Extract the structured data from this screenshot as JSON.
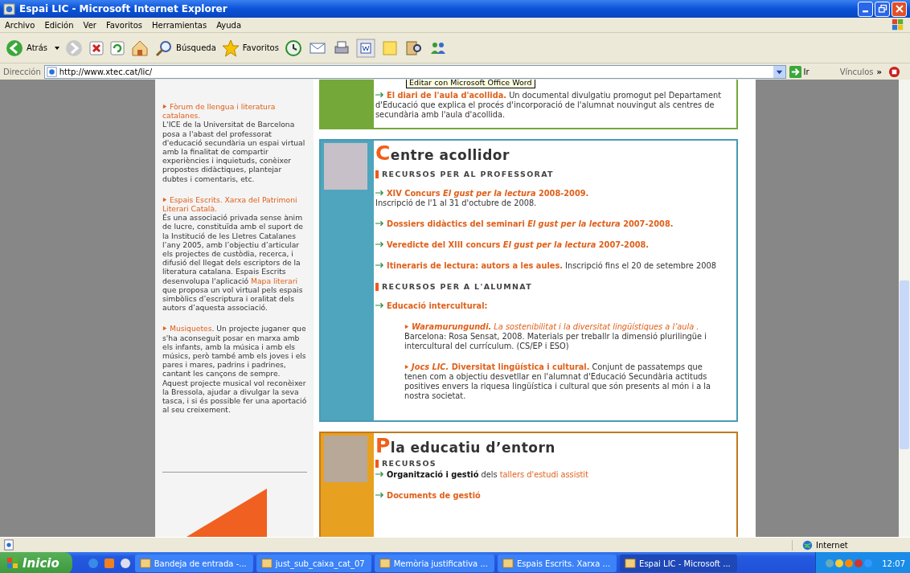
{
  "window": {
    "title": "Espai LIC - Microsoft Internet Explorer"
  },
  "menu": [
    "Archivo",
    "Edición",
    "Ver",
    "Favoritos",
    "Herramientas",
    "Ayuda"
  ],
  "toolbar": {
    "back": "Atrás",
    "search": "Búsqueda",
    "favorites": "Favoritos"
  },
  "address": {
    "label": "Dirección",
    "value": "http://www.xtec.cat/lic/",
    "go": "Ir",
    "links": "Vínculos",
    "more": "»"
  },
  "tooltip": "Editar con Microsoft Office Word",
  "sidebar": [
    {
      "paragraphs": [
        [
          {
            "kind": "link",
            "text": "Fòrum de llengua i literatura catalanes."
          }
        ],
        [
          {
            "kind": "text",
            "text": "L'ICE de la Universitat de Barcelona posa a l'abast del professorat d'educació secundària un espai virtual amb la finalitat de compartir experiències i inquietuds, conèixer propostes didàctiques, plantejar dubtes i comentaris, etc."
          }
        ]
      ]
    },
    {
      "paragraphs": [
        [
          {
            "kind": "link",
            "text": "Espais Escrits. Xarxa del Patrimoni Literari Català."
          }
        ],
        [
          {
            "kind": "text",
            "text": "És una associació privada sense ànim de lucre, constituïda amb el suport de la Institució de les Lletres Catalanes l’any 2005, amb l’objectiu d’articular els projectes de custòdia, recerca, i difusió del llegat dels escriptors de la literatura catalana. Espais Escrits desenvolupa l'aplicació "
          },
          {
            "kind": "link",
            "text": "Mapa literari"
          },
          {
            "kind": "text",
            "text": " que proposa un vol virtual pels espais simbòlics d’escriptura i oralitat dels autors d’aquesta associació."
          }
        ]
      ]
    },
    {
      "paragraphs": [
        [
          {
            "kind": "link",
            "text": "Musiquetes"
          },
          {
            "kind": "text",
            "text": ". Un projecte juganer que s'ha aconseguit posar en marxa amb els infants, amb la música i amb els músics, però també amb els joves i els pares i mares, padrins i padrines, cantant les cançons de sempre."
          }
        ],
        [
          {
            "kind": "text",
            "text": "Aquest projecte musical vol reconèixer la Bressola, ajudar a divulgar la seva tasca, i si és possible fer una aportació al seu creixement."
          }
        ]
      ]
    }
  ],
  "boxes": [
    {
      "kind": "green",
      "sections": [
        {
          "items": [
            {
              "paragraphs": [
                [
                  {
                    "kind": "link",
                    "text": "El diari de l'aula d'acollida."
                  },
                  {
                    "kind": "text",
                    "text": " Un documental divulgatiu promogut pel Departament d'Educació que explica el procés d'incorporació de l'alumnat nouvingut als centres de secundària amb l'aula d'acollida."
                  }
                ]
              ]
            }
          ]
        }
      ]
    },
    {
      "kind": "teal",
      "heading": "Centre acollidor",
      "sections": [
        {
          "title": "RECURSOS PER AL PROFESSORAT",
          "items": [
            {
              "paragraphs": [
                [
                  {
                    "kind": "link",
                    "text": "XIV Concurs *El gust per la lectura* 2008-2009."
                  }
                ],
                [
                  {
                    "kind": "text",
                    "text": "Inscripció de l'1 al 31 d'octubre de 2008."
                  }
                ]
              ]
            },
            {
              "paragraphs": [
                [
                  {
                    "kind": "link",
                    "text": "Dossiers didàctics del seminari *El gust per la lectura* 2007-2008."
                  }
                ]
              ]
            },
            {
              "paragraphs": [
                [
                  {
                    "kind": "link",
                    "text": "Veredicte del XIII concurs *El gust per la lectura* 2007-2008."
                  }
                ]
              ]
            },
            {
              "paragraphs": [
                [
                  {
                    "kind": "link",
                    "text": "Itineraris de lectura: autors a les aules."
                  },
                  {
                    "kind": "text",
                    "text": " Inscripció fins el 20 de setembre 2008"
                  }
                ]
              ]
            }
          ]
        },
        {
          "title": "RECURSOS PER A L'ALUMNAT",
          "items": [
            {
              "paragraphs": [
                [
                  {
                    "kind": "link",
                    "text": "Educació intercultural:"
                  }
                ]
              ],
              "children": [
                {
                  "paragraphs": [
                    [
                      {
                        "kind": "link-italic",
                        "text": "**Waramurungundi.** La sostenibilitat i la diversitat lingüístiques a l’aula ."
                      }
                    ],
                    [
                      {
                        "kind": "text",
                        "text": "Barcelona: Rosa Sensat, 2008. Materials per treballr la dimensió plurilingüe i intercultural del currículum. (CS/EP i ESO)"
                      }
                    ]
                  ]
                },
                {
                  "paragraphs": [
                    [
                      {
                        "kind": "link",
                        "text": "*Jocs LIC.* Diversitat lingüística i cultural."
                      },
                      {
                        "kind": "text",
                        "text": " Conjunt de passatemps que tenen com a objectiu desvetllar en l'alumnat d'Educació Secundària actituds positives envers la riquesa lingüística i cultural que són presents al món i a la nostra societat."
                      }
                    ]
                  ]
                }
              ]
            }
          ]
        }
      ]
    },
    {
      "kind": "orange",
      "heading": "Pla educatiu d’entorn",
      "sections": [
        {
          "title": "RECURSOS",
          "items": [
            {
              "paragraphs": [
                [
                  {
                    "kind": "strong",
                    "text": "Organització i gestió"
                  },
                  {
                    "kind": "text",
                    "text": " dels "
                  },
                  {
                    "kind": "link-light",
                    "text": "tallers d'estudi assistit"
                  }
                ]
              ]
            },
            {
              "paragraphs": [
                [
                  {
                    "kind": "link",
                    "text": "Documents de gestió"
                  }
                ]
              ]
            }
          ]
        }
      ]
    }
  ],
  "status_bar": {
    "zone": "Internet"
  },
  "taskbar": {
    "start": "Inicio",
    "tasks": [
      {
        "label": "Bandeja de entrada -...",
        "selected": false
      },
      {
        "label": "just_sub_caixa_cat_07",
        "selected": false
      },
      {
        "label": "Memòria justificativa ...",
        "selected": false
      },
      {
        "label": "Espais Escrits. Xarxa ...",
        "selected": false
      },
      {
        "label": "Espai LIC - Microsoft ...",
        "selected": true
      }
    ],
    "clock": "12:07"
  }
}
